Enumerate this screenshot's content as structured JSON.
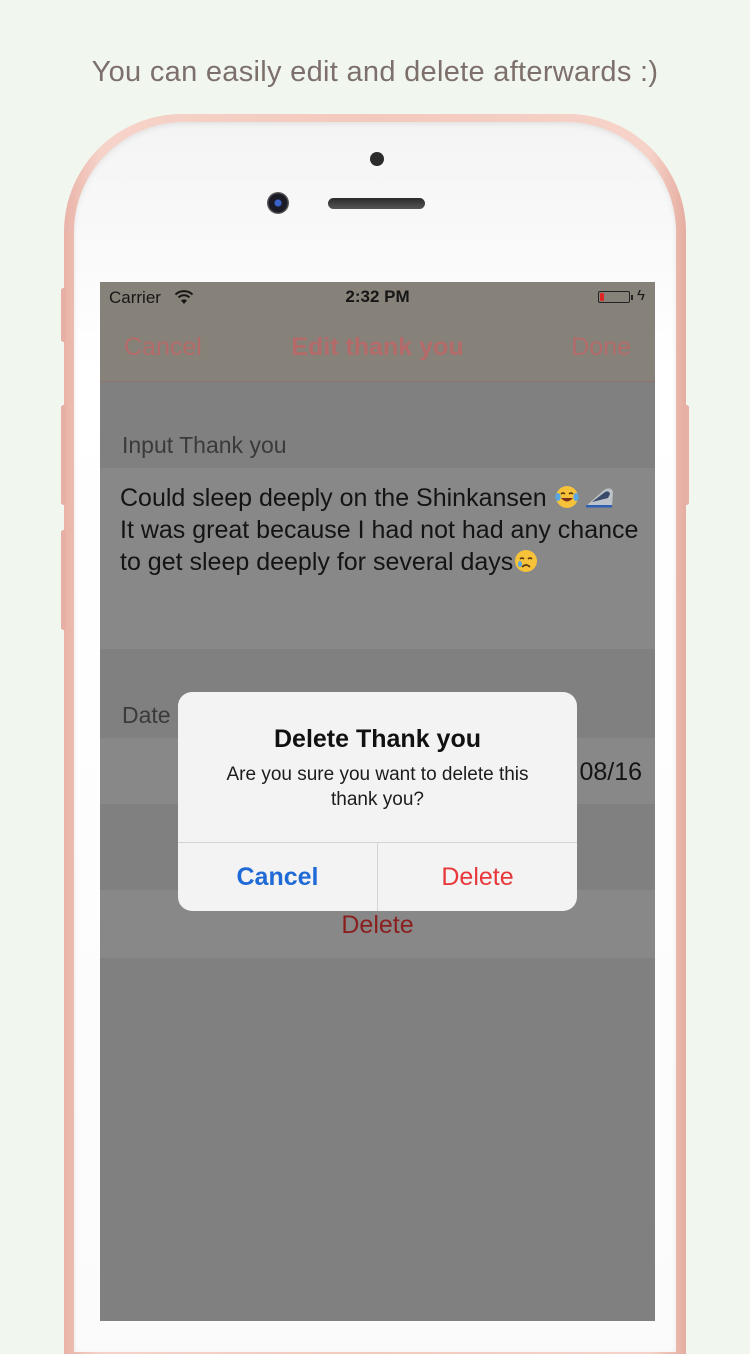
{
  "caption": "You can easily edit and delete afterwards :)",
  "status_bar": {
    "carrier": "Carrier",
    "time": "2:32 PM",
    "battery_level": 0.15,
    "battery_color": "#e02424"
  },
  "nav_bar": {
    "cancel_label": "Cancel",
    "title": "Edit thank you",
    "done_label": "Done",
    "tint_color": "#b46a69"
  },
  "form": {
    "input_section_label": "Input Thank you",
    "thank_you_text_line1": "Could sleep deeply on the Shinkansen ",
    "thank_you_text_line2": "It was great because I had not had any chance to get sleep deeply for several days",
    "emojis": [
      "face-with-tears-of-joy-emoji",
      "bullet-train-emoji",
      "crying-face-emoji"
    ],
    "date_section_label": "Date",
    "date_value": "08/16",
    "delete_label": "Delete"
  },
  "alert": {
    "title": "Delete Thank you",
    "message": "Are you sure you want to delete this thank you?",
    "cancel_label": "Cancel",
    "delete_label": "Delete",
    "cancel_color": "#1f6ad6",
    "delete_color": "#e8383b"
  }
}
